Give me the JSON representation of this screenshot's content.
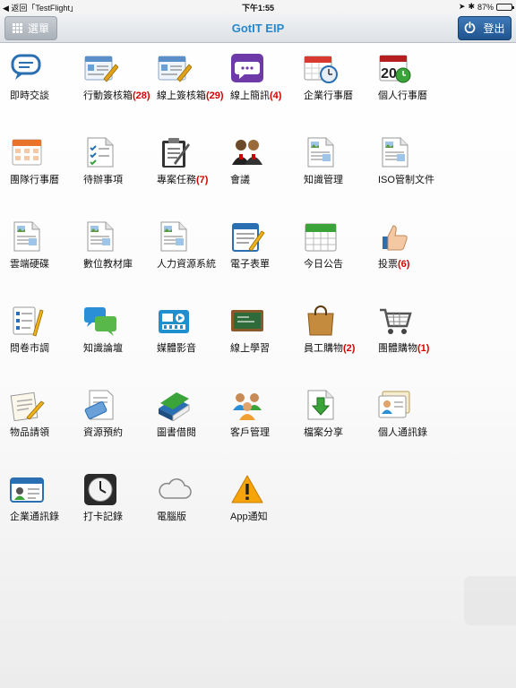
{
  "status_bar": {
    "back_app": "◀ 返回「TestFlight」",
    "time": "下午1:55",
    "battery_text": "87%",
    "battery_level": 0.87
  },
  "nav": {
    "menu_label": "選單",
    "title": "GotIT EIP",
    "logout_label": "登出"
  },
  "apps": [
    {
      "label": "即時交談",
      "badge": "",
      "icon": "chat-bubble"
    },
    {
      "label": "行動簽核箱",
      "badge": "(28)",
      "icon": "form-pen"
    },
    {
      "label": "線上簽核箱",
      "badge": "(29)",
      "icon": "form-pen"
    },
    {
      "label": "線上簡訊",
      "badge": "(4)",
      "icon": "message"
    },
    {
      "label": "企業行事曆",
      "badge": "",
      "icon": "calendar-clock"
    },
    {
      "label": "個人行事曆",
      "badge": "",
      "icon": "calendar-20"
    },
    {
      "label": "團隊行事曆",
      "badge": "",
      "icon": "calendar-grid"
    },
    {
      "label": "待辦事項",
      "badge": "",
      "icon": "checklist-doc"
    },
    {
      "label": "專案任務",
      "badge": "(7)",
      "icon": "clipboard"
    },
    {
      "label": "會議",
      "badge": "",
      "icon": "people-meeting"
    },
    {
      "label": "知識管理",
      "badge": "",
      "icon": "document-image"
    },
    {
      "label": "ISO管制文件",
      "badge": "",
      "icon": "document-image"
    },
    {
      "label": "雲端硬碟",
      "badge": "",
      "icon": "document-image"
    },
    {
      "label": "數位教材庫",
      "badge": "",
      "icon": "document-image"
    },
    {
      "label": "人力資源系統",
      "badge": "",
      "icon": "document-image"
    },
    {
      "label": "電子表單",
      "badge": "",
      "icon": "notepad-pencil"
    },
    {
      "label": "今日公告",
      "badge": "",
      "icon": "calendar-green"
    },
    {
      "label": "投票",
      "badge": "(6)",
      "icon": "thumbs-up"
    },
    {
      "label": "問卷市調",
      "badge": "",
      "icon": "survey-pencil"
    },
    {
      "label": "知識論壇",
      "badge": "",
      "icon": "forum-bubbles"
    },
    {
      "label": "媒體影音",
      "badge": "",
      "icon": "media"
    },
    {
      "label": "線上學習",
      "badge": "",
      "icon": "chalkboard"
    },
    {
      "label": "員工購物",
      "badge": "(2)",
      "icon": "shopping-bag"
    },
    {
      "label": "團體購物",
      "badge": "(1)",
      "icon": "shopping-cart"
    },
    {
      "label": "物品請領",
      "badge": "",
      "icon": "paper-pencil"
    },
    {
      "label": "資源預約",
      "badge": "",
      "icon": "reservation"
    },
    {
      "label": "圖書借閱",
      "badge": "",
      "icon": "books"
    },
    {
      "label": "客戶管理",
      "badge": "",
      "icon": "people-group"
    },
    {
      "label": "檔案分享",
      "badge": "",
      "icon": "download-doc"
    },
    {
      "label": "個人通訊錄",
      "badge": "",
      "icon": "contact-card"
    },
    {
      "label": "企業通訊錄",
      "badge": "",
      "icon": "id-card"
    },
    {
      "label": "打卡記錄",
      "badge": "",
      "icon": "clock"
    },
    {
      "label": "電腦版",
      "badge": "",
      "icon": "cloud"
    },
    {
      "label": "App通知",
      "badge": "",
      "icon": "warning"
    }
  ]
}
